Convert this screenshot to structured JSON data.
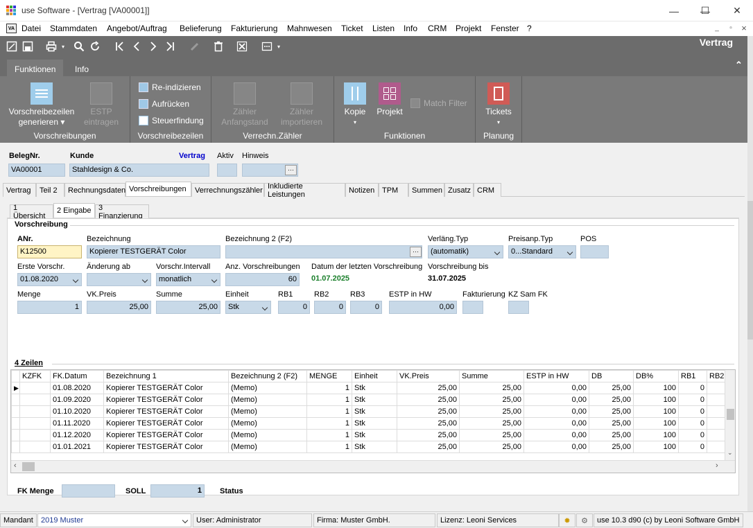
{
  "window": {
    "title": "use Software - [Vertrag [VA00001]]",
    "minimize": "—",
    "maximize": "☐",
    "close": "✕"
  },
  "menu": [
    "Datei",
    "Stammdaten",
    "Angebot/Auftrag",
    "Belieferung",
    "Fakturierung",
    "Mahnwesen",
    "Ticket",
    "Listen",
    "Info",
    "CRM",
    "Projekt",
    "Fenster",
    "?"
  ],
  "menu_logo": "VA",
  "mdi": {
    "minimize": "_",
    "restore": "▫",
    "close": "×"
  },
  "doc_title": "Vertrag",
  "ribbon": {
    "tabs": [
      "Funktionen",
      "Info"
    ],
    "collapse": "⌃",
    "groups": {
      "vorschreibungen": {
        "label": "Vorschreibungen",
        "gen": "Vorschreibezeilen",
        "gen2": "generieren ▾",
        "estp": "ESTP",
        "estp2": "eintragen"
      },
      "vorschreibezeilen": {
        "label": "Vorschreibezeilen",
        "reindex": "Re-indizieren",
        "aufruecken": "Aufrücken",
        "steuer": "Steuerfindung"
      },
      "zaehler": {
        "label": "Verrechn.Zähler",
        "anf": "Zähler",
        "anf2": "Anfangstand",
        "imp": "Zähler",
        "imp2": "importieren"
      },
      "funktionen": {
        "label": "Funktionen",
        "kopie": "Kopie",
        "kopie2": "▾",
        "projekt": "Projekt",
        "match": "Match Filter"
      },
      "planung": {
        "label": "Planung",
        "tickets": "Tickets",
        "tickets2": "▾"
      }
    }
  },
  "header": {
    "beleg_label": "BelegNr.",
    "beleg": "VA00001",
    "kunde_label": "Kunde",
    "kunde": "Stahldesign & Co.",
    "vertrag_label": "Vertrag",
    "aktiv_label": "Aktiv",
    "hinweis_label": "Hinweis",
    "ellipsis": "···"
  },
  "main_tabs": [
    "Vertrag",
    "Teil 2",
    "Rechnungsdaten",
    "Vorschreibungen",
    "Verrechnungszähler",
    "Inkludierte Leistungen",
    "Notizen",
    "TPM",
    "Summen",
    "Zusatz",
    "CRM"
  ],
  "sub_tabs": [
    "1 Übersicht",
    "2 Eingabe",
    "3 Finanzierung"
  ],
  "vorschreibung": {
    "section": "Vorschreibung",
    "anr_label": "ANr.",
    "anr": "K12500",
    "bez_label": "Bezeichnung",
    "bez": "Kopierer TESTGERÄT Color",
    "bez2_label": "Bezeichnung 2 (F2)",
    "bez2": "",
    "verlaeng_label": "Verläng.Typ",
    "verlaeng": "(automatik)",
    "preisanp_label": "Preisanp.Typ",
    "preisanp": "0...Standard",
    "pos_label": "POS",
    "pos": "",
    "erste_label": "Erste Vorschr.",
    "erste": "01.08.2020",
    "aend_label": "Änderung ab",
    "aend": "",
    "intervall_label": "Vorschr.Intervall",
    "intervall": "monatlich",
    "anz_label": "Anz. Vorschreibungen",
    "anz": "60",
    "letzte_label": "Datum der letzten Vorschreibung",
    "letzte": "01.07.2025",
    "bis_label": "Vorschreibung bis",
    "bis": "31.07.2025",
    "menge_label": "Menge",
    "menge": "1",
    "vkpreis_label": "VK.Preis",
    "vkpreis": "25,00",
    "summe_label": "Summe",
    "summe": "25,00",
    "einheit_label": "Einheit",
    "einheit": "Stk",
    "rb1_label": "RB1",
    "rb1": "0",
    "rb2_label": "RB2",
    "rb2": "0",
    "rb3_label": "RB3",
    "rb3": "0",
    "estp_label": "ESTP in HW",
    "estp": "0,00",
    "fakt_label": "Fakturierung",
    "fakt": "",
    "kz_label": "KZ Sam FK",
    "kz": ""
  },
  "zeilen": {
    "section": "4 Zeilen",
    "columns": [
      "KZFK",
      "FK.Datum",
      "Bezeichnung 1",
      "Bezeichnung 2 (F2)",
      "MENGE",
      "Einheit",
      "VK.Preis",
      "Summe",
      "ESTP in HW",
      "DB",
      "DB%",
      "RB1",
      "RB2"
    ],
    "rows": [
      [
        "",
        "01.08.2020",
        "Kopierer TESTGERÄT Color",
        "(Memo)",
        "1",
        "Stk",
        "25,00",
        "25,00",
        "0,00",
        "25,00",
        "100",
        "0",
        ""
      ],
      [
        "",
        "01.09.2020",
        "Kopierer TESTGERÄT Color",
        "(Memo)",
        "1",
        "Stk",
        "25,00",
        "25,00",
        "0,00",
        "25,00",
        "100",
        "0",
        ""
      ],
      [
        "",
        "01.10.2020",
        "Kopierer TESTGERÄT Color",
        "(Memo)",
        "1",
        "Stk",
        "25,00",
        "25,00",
        "0,00",
        "25,00",
        "100",
        "0",
        ""
      ],
      [
        "",
        "01.11.2020",
        "Kopierer TESTGERÄT Color",
        "(Memo)",
        "1",
        "Stk",
        "25,00",
        "25,00",
        "0,00",
        "25,00",
        "100",
        "0",
        ""
      ],
      [
        "",
        "01.12.2020",
        "Kopierer TESTGERÄT Color",
        "(Memo)",
        "1",
        "Stk",
        "25,00",
        "25,00",
        "0,00",
        "25,00",
        "100",
        "0",
        ""
      ],
      [
        "",
        "01.01.2021",
        "Kopierer TESTGERÄT Color",
        "(Memo)",
        "1",
        "Stk",
        "25,00",
        "25,00",
        "0,00",
        "25,00",
        "100",
        "0",
        ""
      ]
    ]
  },
  "footer": {
    "fkmenge_label": "FK Menge",
    "fkmenge": "",
    "soll_label": "SOLL",
    "soll": "1",
    "status_label": "Status"
  },
  "statusbar": {
    "mandant_label": "Mandant",
    "mandant": "2019 Muster",
    "user": "User: Administrator",
    "firma": "Firma: Muster GmbH.",
    "lizenz": "Lizenz: Leoni Services",
    "version": "use 10.3 d90 (c) by Leoni Software GmbH"
  },
  "colors": {
    "toolbar": "#6c6c6c",
    "ribbon": "#7a7a7a",
    "field": "#c8d9e8",
    "highlight": "#fff4c5",
    "vertrag_label": "#0000cc",
    "green": "#1a7f2b",
    "tickets": "#c0504d",
    "projekt": "#9b4a7a"
  }
}
